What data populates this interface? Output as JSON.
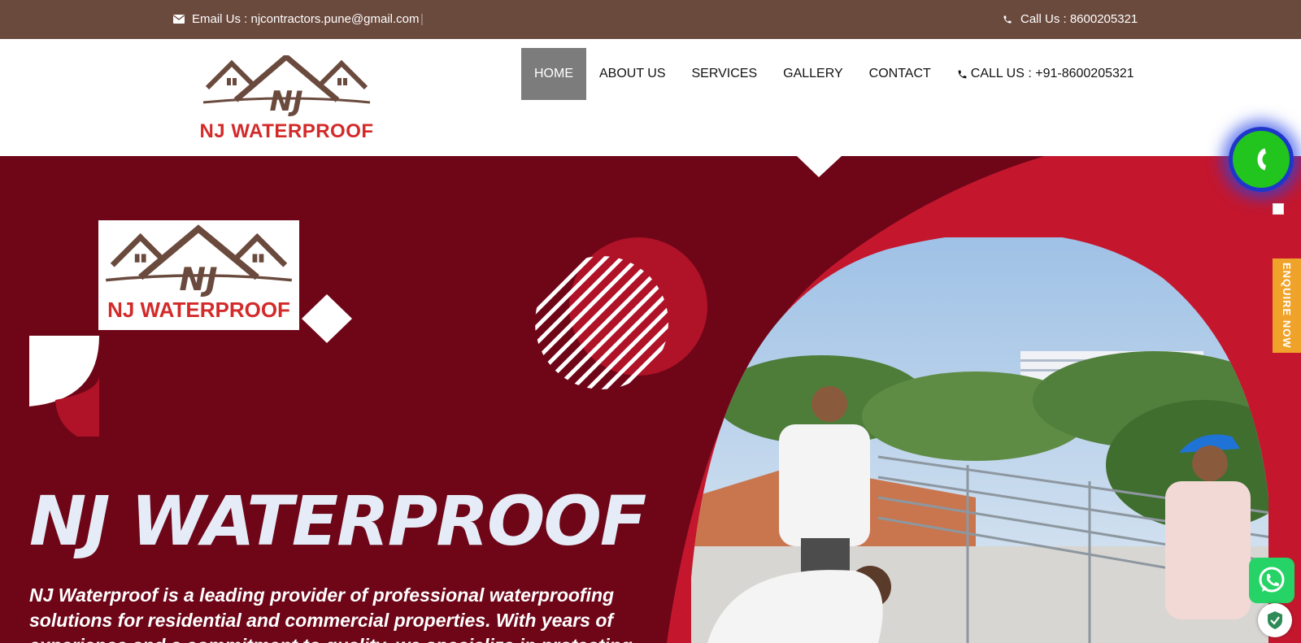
{
  "topbar": {
    "email_text": "Email Us : njcontractors.pune@gmail.com",
    "separator": "|",
    "call_text": "Call Us : 8600205321",
    "email_icon": "envelope-icon",
    "phone_icon": "phone-icon"
  },
  "header": {
    "logo_text": "NJ WATERPROOF",
    "nav": [
      {
        "label": "HOME",
        "active": true
      },
      {
        "label": "ABOUT US"
      },
      {
        "label": "SERVICES"
      },
      {
        "label": "GALLERY"
      },
      {
        "label": "CONTACT"
      },
      {
        "label": "CALL US : +91-8600205321",
        "icon": "phone-icon"
      }
    ]
  },
  "hero": {
    "logo_text": "NJ WATERPROOF",
    "title": "NJ WATERPROOF",
    "description": "NJ Waterproof is a leading provider of professional waterproofing solutions for residential and commercial properties. With years of experience and a commitment to quality, we specialize in protecting"
  },
  "widgets": {
    "enquire_label": "ENQUIRE NOW",
    "call_icon": "phone-icon",
    "whatsapp_icon": "whatsapp-icon",
    "shield_icon": "shield-check-icon"
  },
  "colors": {
    "topbar": "#6b4a3e",
    "hero_bg": "#6e0618",
    "hero_accent": "#c4172e",
    "brand_red": "#d32a2a",
    "enquire": "#f0a32a",
    "whatsapp": "#25d366"
  }
}
